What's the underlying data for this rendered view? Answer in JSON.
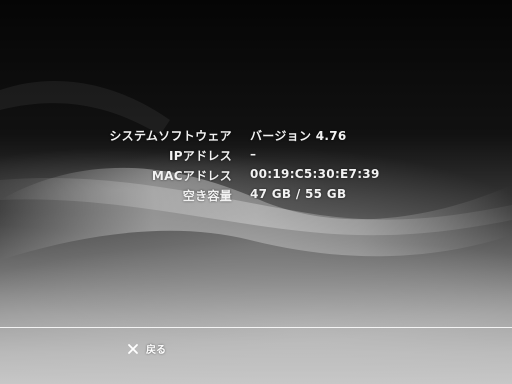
{
  "system_info": {
    "rows": [
      {
        "label": "システムソフトウェア",
        "value": "バージョン 4.76"
      },
      {
        "label": "IPアドレス",
        "value": "–"
      },
      {
        "label": "MACアドレス",
        "value": "00:19:C5:30:E7:39"
      },
      {
        "label": "空き容量",
        "value": "47 GB / 55 GB"
      }
    ]
  },
  "footer": {
    "back_icon": "cross-icon",
    "back_label": "戻る"
  },
  "colors": {
    "text": "#f2f2f2",
    "divider": "#ffffff"
  }
}
